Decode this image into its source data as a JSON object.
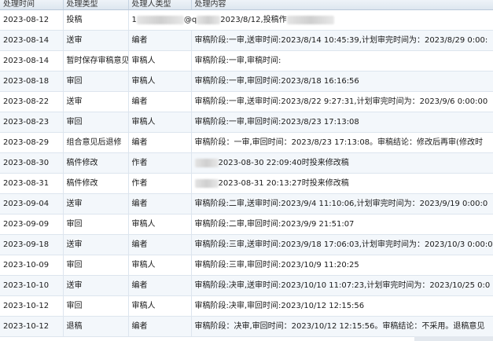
{
  "table": {
    "headers": [
      "处理时间",
      "处理类型",
      "处理人类型",
      "处理内容"
    ],
    "rows": [
      {
        "time": "2023-08-12",
        "type": "投稿",
        "role": "",
        "content": "1",
        "content_tail": "@q",
        "content_mid": "2023/8/12,投稿作"
      },
      {
        "time": "2023-08-14",
        "type": "送审",
        "role": "编者",
        "content": "审稿阶段:一审,送审时间:2023/8/14 10:45:39,计划审完时间为：2023/8/29 0:00:"
      },
      {
        "time": "2023-08-14",
        "type": "暂时保存审稿意见",
        "role": "审稿人",
        "content": "审稿阶段:一审,审稿时间:"
      },
      {
        "time": "2023-08-18",
        "type": "审回",
        "role": "审稿人",
        "content": "审稿阶段:一审,审回时间:2023/8/18 16:16:56"
      },
      {
        "time": "2023-08-22",
        "type": "送审",
        "role": "编者",
        "content": "审稿阶段:一审,送审时间:2023/8/22 9:27:31,计划审完时间为：2023/9/6 0:00:00"
      },
      {
        "time": "2023-08-23",
        "type": "审回",
        "role": "审稿人",
        "content": "审稿阶段:一审,审回时间:2023/8/23 17:13:08"
      },
      {
        "time": "2023-08-29",
        "type": "组合意见后退修",
        "role": "编者",
        "content": "审稿阶段：一审,审回时间：2023/8/23 17:13:08。审稿结论：修改后再审(修改时"
      },
      {
        "time": "2023-08-30",
        "type": "稿件修改",
        "role": "作者",
        "content": "2023-08-30 22:09:40时投来修改稿"
      },
      {
        "time": "2023-08-31",
        "type": "稿件修改",
        "role": "作者",
        "content": "2023-08-31 20:13:27时投来修改稿"
      },
      {
        "time": "2023-09-04",
        "type": "送审",
        "role": "编者",
        "content": "审稿阶段:二审,送审时间:2023/9/4 11:10:06,计划审完时间为：2023/9/19 0:00:0"
      },
      {
        "time": "2023-09-09",
        "type": "审回",
        "role": "审稿人",
        "content": "审稿阶段:二审,审回时间:2023/9/9 21:51:07"
      },
      {
        "time": "2023-09-18",
        "type": "送审",
        "role": "编者",
        "content": "审稿阶段:三审,送审时间:2023/9/18 17:06:03,计划审完时间为：2023/10/3 0:00:0"
      },
      {
        "time": "2023-10-09",
        "type": "审回",
        "role": "审稿人",
        "content": "审稿阶段:三审,审回时间:2023/10/9 11:20:25"
      },
      {
        "time": "2023-10-10",
        "type": "送审",
        "role": "编者",
        "content": "审稿阶段:决审,送审时间:2023/10/10 11:07:23,计划审完时间为：2023/10/25 0:0"
      },
      {
        "time": "2023-10-12",
        "type": "审回",
        "role": "审稿人",
        "content": "审稿阶段:决审,审回时间:2023/10/12 12:15:56"
      },
      {
        "time": "2023-10-12",
        "type": "退稿",
        "role": "编者",
        "content": "审稿阶段：决审,审回时间：2023/10/12 12:15:56。审稿结论：不采用。退稿意见"
      }
    ]
  }
}
